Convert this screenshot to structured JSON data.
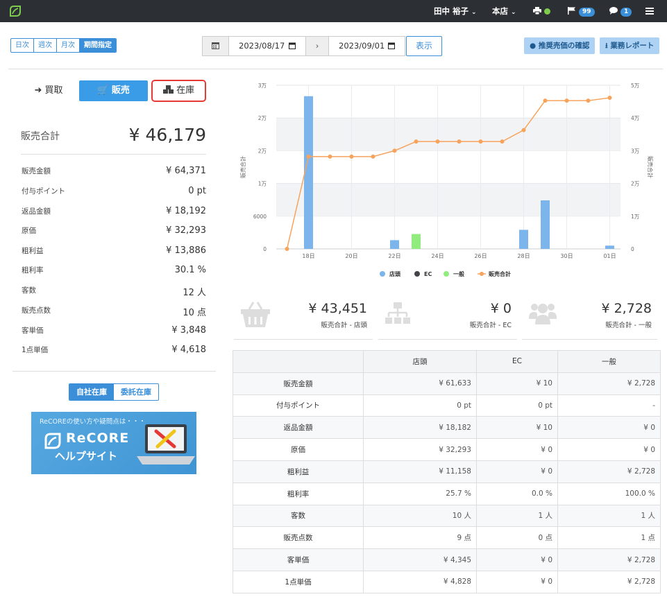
{
  "navbar": {
    "user_name": "田中 裕子",
    "store": "本店",
    "flag_count": "99",
    "message_count": "1"
  },
  "toolbar": {
    "periods": [
      "日次",
      "週次",
      "月次",
      "期間指定"
    ],
    "active_period": "期間指定",
    "date_from": "2023/08/17",
    "date_to": "2023/09/01",
    "show_label": "表示",
    "recommend_label": "推奨売価の確認",
    "report_label": "業務レポート"
  },
  "modes": {
    "buy": "買取",
    "sell": "販売",
    "stock": "在庫"
  },
  "summary": {
    "total_label": "販売合計",
    "total_value": "¥ 46,179",
    "rows": [
      {
        "label": "販売金額",
        "value": "¥ 64,371"
      },
      {
        "label": "付与ポイント",
        "value": "0 pt"
      },
      {
        "label": "返品金額",
        "value": "¥ 18,192"
      },
      {
        "label": "原価",
        "value": "¥ 32,293"
      },
      {
        "label": "粗利益",
        "value": "¥ 13,886"
      },
      {
        "label": "粗利率",
        "value": "30.1 %"
      },
      {
        "label": "客数",
        "value": "12 人"
      },
      {
        "label": "販売点数",
        "value": "10 点"
      },
      {
        "label": "客単価",
        "value": "¥ 3,848"
      },
      {
        "label": "1点単価",
        "value": "¥ 4,618"
      }
    ]
  },
  "stock_tabs": [
    "自社在庫",
    "委託在庫"
  ],
  "banner": {
    "small": "ReCOREの使い方や疑問点は・・・",
    "brand": "ReCORE",
    "help": "ヘルプサイト"
  },
  "chart_data": {
    "type": "bar",
    "x_ticks": [
      "18日",
      "20日",
      "22日",
      "24日",
      "26日",
      "28日",
      "30日",
      "01日"
    ],
    "y_left_ticks": [
      "0",
      "6000",
      "1万",
      "2万",
      "2万",
      "3万"
    ],
    "y_right_ticks": [
      "0",
      "1万",
      "2万",
      "3万",
      "4万",
      "5万"
    ],
    "y_left_label": "販売合計",
    "y_right_label": "販売合計",
    "dates": [
      "2023-08-17",
      "2023-08-18",
      "2023-08-19",
      "2023-08-20",
      "2023-08-21",
      "2023-08-22",
      "2023-08-23",
      "2023-08-24",
      "2023-08-25",
      "2023-08-26",
      "2023-08-27",
      "2023-08-28",
      "2023-08-29",
      "2023-08-30",
      "2023-08-31",
      "2023-09-01"
    ],
    "series": [
      {
        "name": "店頭",
        "kind": "bar",
        "color": "#7cb5ec",
        "values": [
          0,
          28000,
          0,
          0,
          0,
          1600,
          0,
          0,
          0,
          0,
          0,
          3500,
          8900,
          0,
          0,
          600
        ]
      },
      {
        "name": "EC",
        "kind": "bar",
        "color": "#434348",
        "values": [
          0,
          0,
          0,
          0,
          0,
          0,
          0,
          0,
          0,
          0,
          0,
          0,
          0,
          0,
          0,
          0
        ]
      },
      {
        "name": "一般",
        "kind": "bar",
        "color": "#90ed7d",
        "values": [
          0,
          0,
          0,
          0,
          0,
          0,
          2728,
          0,
          0,
          0,
          0,
          0,
          0,
          0,
          0,
          0
        ]
      },
      {
        "name": "販売合計",
        "kind": "line",
        "color": "#f7a35c",
        "values": [
          0,
          28200,
          28200,
          28200,
          28200,
          30000,
          32800,
          32800,
          32800,
          32800,
          32800,
          36300,
          45300,
          45300,
          45300,
          46179
        ]
      }
    ],
    "y_left_max": 30000,
    "y_right_max": 50000,
    "legend_position": "bottom"
  },
  "channel_summary": [
    {
      "value": "¥ 43,451",
      "label": "販売合計 - 店頭",
      "icon": "basket-icon"
    },
    {
      "value": "¥ 0",
      "label": "販売合計 - EC",
      "icon": "sitemap-icon"
    },
    {
      "value": "¥ 2,728",
      "label": "販売合計 - 一般",
      "icon": "users-icon"
    }
  ],
  "table": {
    "headers": [
      "",
      "店頭",
      "EC",
      "一般"
    ],
    "rows": [
      [
        "販売金額",
        "¥ 61,633",
        "¥ 10",
        "¥ 2,728"
      ],
      [
        "付与ポイント",
        "0 pt",
        "0 pt",
        "-"
      ],
      [
        "返品金額",
        "¥ 18,182",
        "¥ 10",
        "¥ 0"
      ],
      [
        "原価",
        "¥ 32,293",
        "¥ 0",
        "¥ 0"
      ],
      [
        "粗利益",
        "¥ 11,158",
        "¥ 0",
        "¥ 2,728"
      ],
      [
        "粗利率",
        "25.7 %",
        "0.0 %",
        "100.0 %"
      ],
      [
        "客数",
        "10 人",
        "1 人",
        "1 人"
      ],
      [
        "販売点数",
        "9 点",
        "0 点",
        "1 点"
      ],
      [
        "客単価",
        "¥ 4,345",
        "¥ 0",
        "¥ 2,728"
      ],
      [
        "1点単価",
        "¥ 4,828",
        "¥ 0",
        "¥ 2,728"
      ]
    ]
  },
  "colors": {
    "accent": "#3a8fd8",
    "navbar": "#2c2f33",
    "highlight": "#e53935"
  }
}
